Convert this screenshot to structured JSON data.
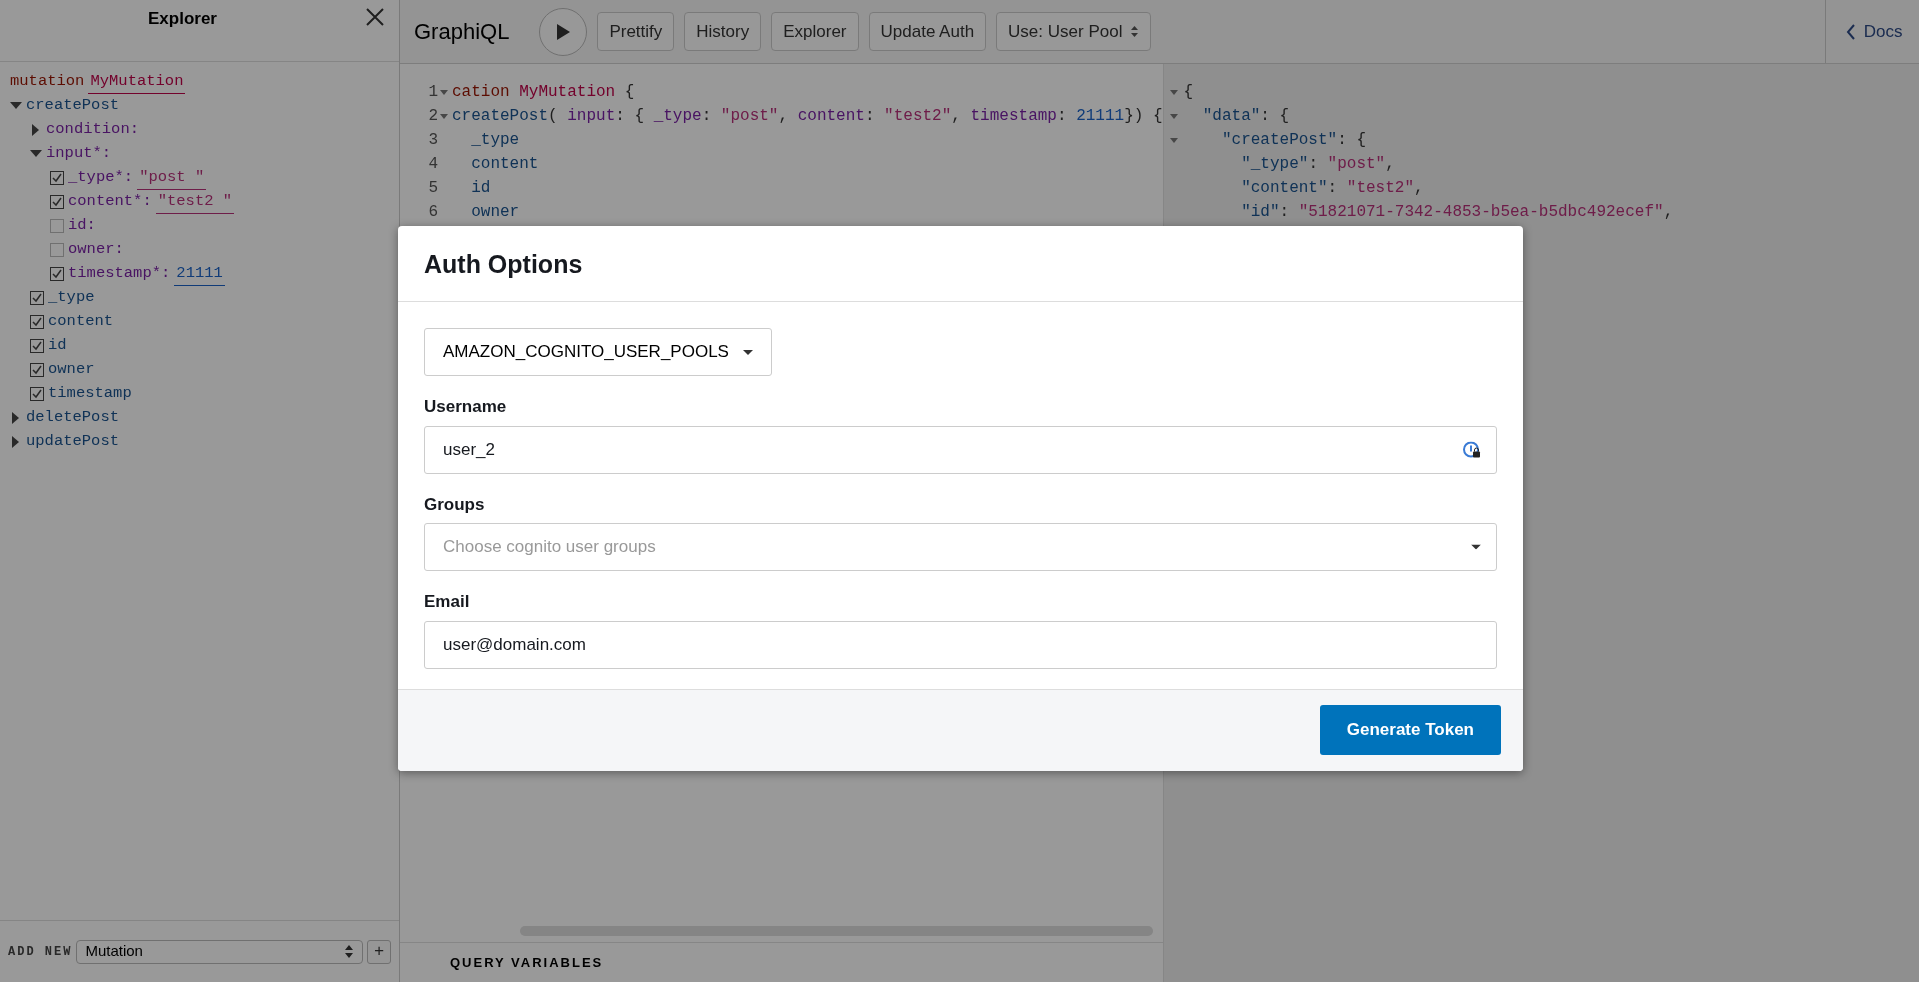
{
  "explorer": {
    "title": "Explorer",
    "operation": {
      "keyword": "mutation",
      "name": "MyMutation"
    },
    "tree": [
      {
        "kind": "root",
        "label": "createPost",
        "expanded": true,
        "children": [
          {
            "kind": "group",
            "label": "condition:",
            "expanded": false
          },
          {
            "kind": "group",
            "label": "input*:",
            "expanded": true,
            "children": [
              {
                "kind": "arg",
                "label": "_type*:",
                "checked": true,
                "value": {
                  "kind": "string",
                  "text": "\"post \""
                }
              },
              {
                "kind": "arg",
                "label": "content*:",
                "checked": true,
                "value": {
                  "kind": "string",
                  "text": "\"test2 \""
                }
              },
              {
                "kind": "arg",
                "label": "id:",
                "checked": false
              },
              {
                "kind": "arg",
                "label": "owner:",
                "checked": false
              },
              {
                "kind": "arg",
                "label": "timestamp*:",
                "checked": true,
                "value": {
                  "kind": "number",
                  "text": "21111"
                }
              }
            ]
          },
          {
            "kind": "field",
            "label": "_type",
            "checked": true
          },
          {
            "kind": "field",
            "label": "content",
            "checked": true
          },
          {
            "kind": "field",
            "label": "id",
            "checked": true
          },
          {
            "kind": "field",
            "label": "owner",
            "checked": true
          },
          {
            "kind": "field",
            "label": "timestamp",
            "checked": true
          }
        ]
      },
      {
        "kind": "root",
        "label": "deletePost",
        "expanded": false
      },
      {
        "kind": "root",
        "label": "updatePost",
        "expanded": false
      }
    ],
    "footer": {
      "label": "ADD NEW",
      "select": "Mutation",
      "add": "+"
    }
  },
  "toolbar": {
    "logo": "GraphiQL",
    "buttons": [
      "Prettify",
      "History",
      "Explorer",
      "Update Auth"
    ],
    "auth_select": "Use: User Pool",
    "docs": "Docs"
  },
  "editor": {
    "lines": [
      {
        "number": "1",
        "foldable": true,
        "tokens": [
          {
            "text": "cation",
            "kind": "keyword"
          },
          {
            "text": "MyMutation",
            "kind": "def"
          },
          {
            "text": "{",
            "kind": "punct"
          }
        ]
      },
      {
        "number": "2",
        "foldable": true,
        "tokens": [
          {
            "text": "createPost",
            "kind": "property"
          },
          {
            "text": "(",
            "kind": "punct"
          },
          {
            "text": "input",
            "kind": "attribute"
          },
          {
            "text": ": {",
            "kind": "punct"
          },
          {
            "text": "_type",
            "kind": "attribute"
          },
          {
            "text": ":",
            "kind": "punct"
          },
          {
            "text": "\"post\"",
            "kind": "string"
          },
          {
            "text": ",",
            "kind": "punct"
          },
          {
            "text": "content",
            "kind": "attribute"
          },
          {
            "text": ":",
            "kind": "punct"
          },
          {
            "text": "\"test2\"",
            "kind": "string"
          },
          {
            "text": ",",
            "kind": "punct"
          },
          {
            "text": "timestamp",
            "kind": "attribute"
          },
          {
            "text": ":",
            "kind": "punct"
          },
          {
            "text": "21111",
            "kind": "number"
          },
          {
            "text": "}) {",
            "kind": "punct"
          }
        ]
      },
      {
        "number": "3",
        "foldable": false,
        "tokens": [
          {
            "text": "_type",
            "kind": "property"
          }
        ]
      },
      {
        "number": "4",
        "foldable": false,
        "tokens": [
          {
            "text": "content",
            "kind": "property"
          }
        ]
      },
      {
        "number": "5",
        "foldable": false,
        "tokens": [
          {
            "text": "id",
            "kind": "property"
          }
        ]
      },
      {
        "number": "6",
        "foldable": false,
        "tokens": [
          {
            "text": "owner",
            "kind": "property"
          }
        ]
      }
    ],
    "variables_title": "QUERY VARIABLES"
  },
  "result": {
    "lines": [
      {
        "foldable": true,
        "tokens": [
          {
            "text": "{",
            "kind": "punct"
          }
        ]
      },
      {
        "foldable": true,
        "tokens": [
          {
            "text": "\"data\"",
            "kind": "property"
          },
          {
            "text": ": {",
            "kind": "punct"
          }
        ]
      },
      {
        "foldable": true,
        "tokens": [
          {
            "text": "\"createPost\"",
            "kind": "property"
          },
          {
            "text": ": {",
            "kind": "punct"
          }
        ]
      },
      {
        "foldable": false,
        "tokens": [
          {
            "text": "\"_type\"",
            "kind": "property"
          },
          {
            "text": ":",
            "kind": "punct"
          },
          {
            "text": "\"post\"",
            "kind": "string"
          },
          {
            "text": ",",
            "kind": "punct"
          }
        ]
      },
      {
        "foldable": false,
        "tokens": [
          {
            "text": "\"content\"",
            "kind": "property"
          },
          {
            "text": ":",
            "kind": "punct"
          },
          {
            "text": "\"test2\"",
            "kind": "string"
          },
          {
            "text": ",",
            "kind": "punct"
          }
        ]
      },
      {
        "foldable": false,
        "tokens": [
          {
            "text": "\"id\"",
            "kind": "property"
          },
          {
            "text": ":",
            "kind": "punct"
          },
          {
            "text": "\"51821071-7342-4853-b5ea-b5dbc492ecef\"",
            "kind": "string"
          },
          {
            "text": ",",
            "kind": "punct"
          }
        ]
      }
    ]
  },
  "modal": {
    "title": "Auth Options",
    "auth_type": "AMAZON_COGNITO_USER_POOLS",
    "fields": [
      {
        "kind": "secure",
        "label": "Username",
        "value": "user_2"
      },
      {
        "kind": "select",
        "label": "Groups",
        "placeholder": "Choose cognito user groups"
      },
      {
        "kind": "text",
        "label": "Email",
        "value": "user@domain.com"
      }
    ],
    "button": "Generate Token"
  }
}
